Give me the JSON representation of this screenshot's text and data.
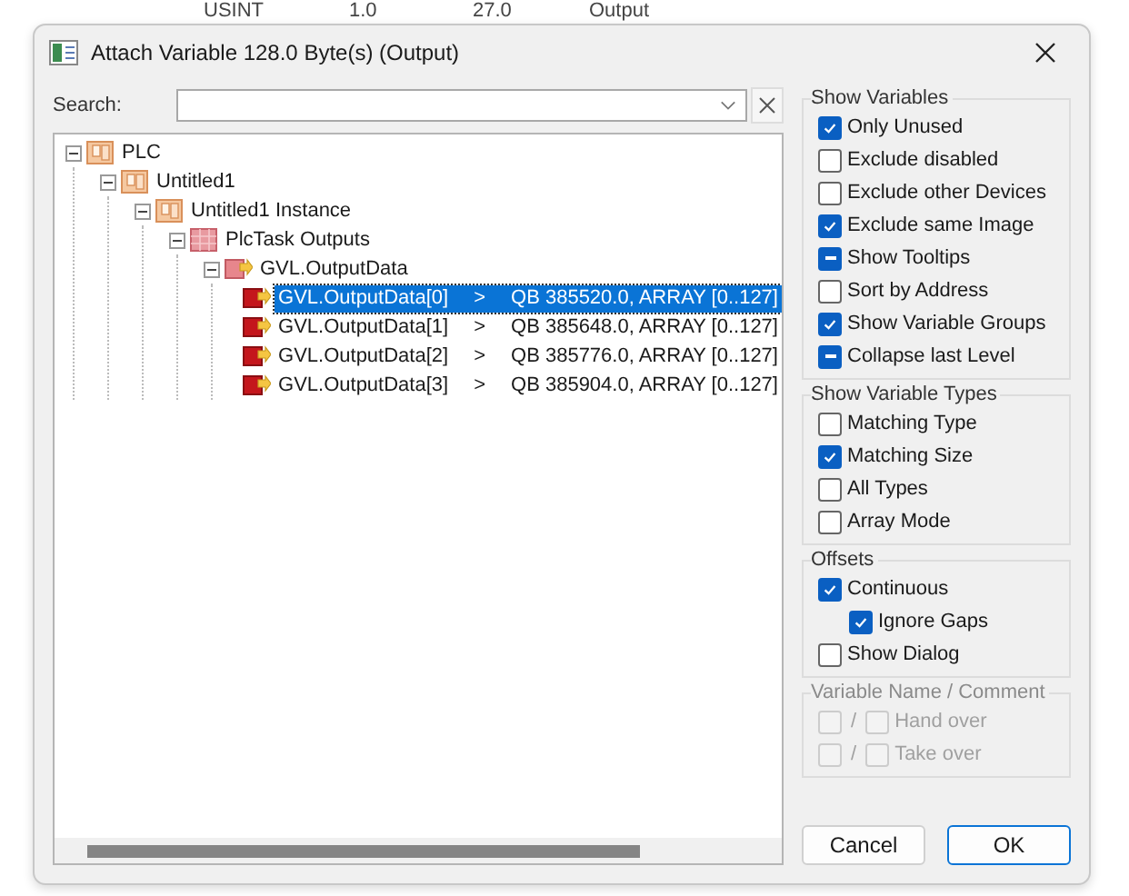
{
  "background_row": [
    "USINT",
    "1.0",
    "27.0",
    "Output"
  ],
  "window": {
    "title": "Attach Variable 128.0 Byte(s) (Output)"
  },
  "search": {
    "label": "Search:"
  },
  "tree": [
    {
      "label": "PLC",
      "kind": "plc",
      "expanded": true,
      "selected": false,
      "children": [
        {
          "label": "Untitled1",
          "kind": "plc",
          "expanded": true,
          "selected": false,
          "children": [
            {
              "label": "Untitled1 Instance",
              "kind": "plc",
              "expanded": true,
              "selected": false,
              "children": [
                {
                  "label": "PlcTask Outputs",
                  "kind": "task",
                  "expanded": true,
                  "selected": false,
                  "children": [
                    {
                      "label": "GVL.OutputData",
                      "kind": "group",
                      "expanded": true,
                      "selected": false,
                      "children": [
                        {
                          "label": "GVL.OutputData[0]",
                          "kind": "var",
                          "arrow": ">",
                          "address": "QB 385520.0, ARRAY [0..127]",
                          "selected": true
                        },
                        {
                          "label": "GVL.OutputData[1]",
                          "kind": "var",
                          "arrow": ">",
                          "address": "QB 385648.0, ARRAY [0..127]",
                          "selected": false
                        },
                        {
                          "label": "GVL.OutputData[2]",
                          "kind": "var",
                          "arrow": ">",
                          "address": "QB 385776.0, ARRAY [0..127]",
                          "selected": false
                        },
                        {
                          "label": "GVL.OutputData[3]",
                          "kind": "var",
                          "arrow": ">",
                          "address": "QB 385904.0, ARRAY [0..127]",
                          "selected": false
                        }
                      ]
                    }
                  ]
                }
              ]
            }
          ]
        }
      ]
    }
  ],
  "groups": [
    {
      "title": "Show Variables",
      "options": [
        {
          "label": "Only Unused",
          "checked": true,
          "indeterminate": false
        },
        {
          "label": "Exclude disabled",
          "checked": false,
          "indeterminate": false
        },
        {
          "label": "Exclude other Devices",
          "checked": false,
          "indeterminate": false
        },
        {
          "label": "Exclude same Image",
          "checked": true,
          "indeterminate": false
        },
        {
          "label": "Show Tooltips",
          "checked": true,
          "indeterminate": true
        },
        {
          "label": "Sort by Address",
          "checked": false,
          "indeterminate": false
        },
        {
          "label": "Show Variable Groups",
          "checked": true,
          "indeterminate": false
        },
        {
          "label": "Collapse last Level",
          "checked": true,
          "indeterminate": true
        }
      ]
    },
    {
      "title": "Show Variable Types",
      "options": [
        {
          "label": "Matching Type",
          "checked": false,
          "indeterminate": false
        },
        {
          "label": "Matching Size",
          "checked": true,
          "indeterminate": false
        },
        {
          "label": "All Types",
          "checked": false,
          "indeterminate": false
        },
        {
          "label": "Array Mode",
          "checked": false,
          "indeterminate": false
        }
      ]
    },
    {
      "title": "Offsets",
      "options": [
        {
          "label": "Continuous",
          "checked": true,
          "indeterminate": false,
          "children": [
            {
              "label": "Ignore Gaps",
              "checked": true,
              "indeterminate": false
            }
          ]
        },
        {
          "label": "Show Dialog",
          "checked": false,
          "indeterminate": false
        }
      ]
    }
  ],
  "name_comment": {
    "title": "Variable Name / Comment",
    "disabled": true,
    "rows": [
      {
        "separator": "/",
        "label": "Hand over",
        "first_checked": false,
        "second_checked": false
      },
      {
        "separator": "/",
        "label": "Take over",
        "first_checked": false,
        "second_checked": false
      }
    ]
  },
  "buttons": [
    {
      "label": "Cancel",
      "default": false
    },
    {
      "label": "OK",
      "default": true
    }
  ]
}
